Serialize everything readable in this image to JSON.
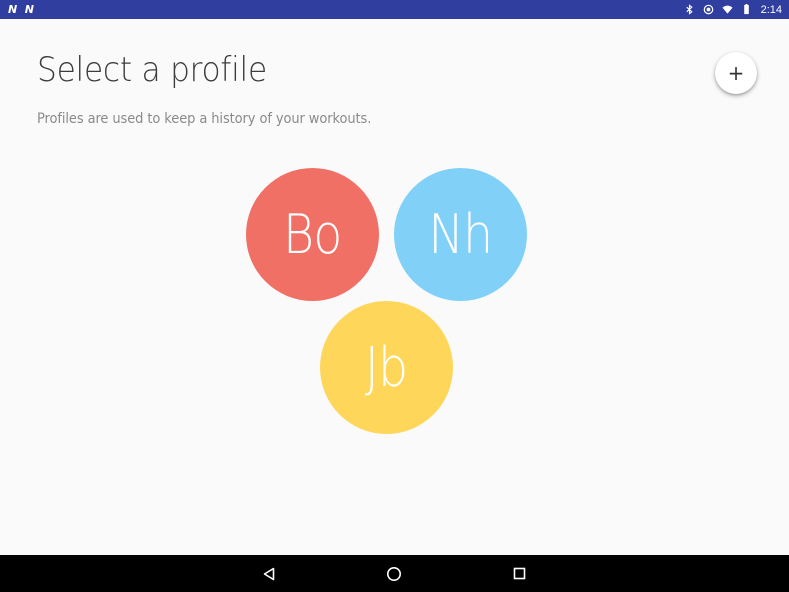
{
  "status_bar": {
    "time": "2:14",
    "left_icons": [
      "N",
      "N"
    ],
    "right_icons": [
      "bluetooth-icon",
      "sync-icon",
      "wifi-icon",
      "battery-icon"
    ]
  },
  "header": {
    "title": "Select a profile",
    "subtitle": "Profiles are used to keep a history of your workouts.",
    "add_label": "+"
  },
  "profiles": [
    {
      "initials": "Bo",
      "color": "#f07066"
    },
    {
      "initials": "Nh",
      "color": "#80d0f8"
    },
    {
      "initials": "Jb",
      "color": "#fed75a"
    }
  ],
  "nav_bar": {
    "icons": [
      "back-icon",
      "home-icon",
      "recents-icon"
    ]
  }
}
